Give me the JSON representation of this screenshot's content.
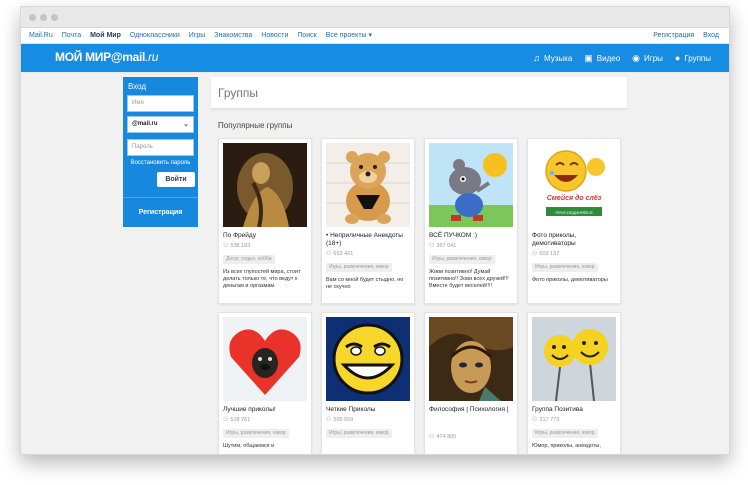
{
  "top_nav": {
    "left": [
      "Mail.Ru",
      "Почта",
      "Мой Мир",
      "Одноклассники",
      "Игры",
      "Знакомства",
      "Новости",
      "Поиск",
      "Все проекты ▾"
    ],
    "active": "Мой Мир",
    "right": [
      "Регистрация",
      "Вход"
    ]
  },
  "banner": {
    "logo_text": "МОЙ МИР@mail",
    "logo_suffix": ".ru",
    "nav": [
      {
        "icon": "music-icon",
        "label": "Музыка"
      },
      {
        "icon": "video-icon",
        "label": "Видео"
      },
      {
        "icon": "gamepad-icon",
        "label": "Игры"
      },
      {
        "icon": "groups-icon",
        "label": "Группы"
      }
    ]
  },
  "login": {
    "title": "Вход",
    "name_placeholder": "Имя",
    "domain_value": "@mail.ru",
    "password_placeholder": "Пароль",
    "restore_link": "Восстановить пароль",
    "submit_label": "Войти",
    "register_label": "Регистрация"
  },
  "page": {
    "title": "Группы",
    "subtitle": "Популярные группы"
  },
  "groups": [
    {
      "title": "По Фрейду",
      "members": "538 183",
      "tag": "Досуг, отдых, хобби",
      "desc": "Из всех глупостей мира, стоит делать только те, что ведут к деньгам и оргазмам."
    },
    {
      "title": "• Неприличные Анекдоты (18+)",
      "members": "653 421",
      "tag": "Игры, развлечения, юмор",
      "desc": "Вам со мной будет стыдно, но не скучно"
    },
    {
      "title": "ВСЁ ПУЧКОМ :)",
      "members": "367 041",
      "tag": "Игры, развлечения, юмор",
      "desc": "Живи позитивно! Думай позитивно!! Зови всех друзей!!! Вместе будет веселей!!!!"
    },
    {
      "title": "Фото приколы, демотиваторы",
      "members": "603 137",
      "tag": "Игры, развлечения, юмор",
      "desc": "Фото приколы, демотиваторы",
      "picture_text_1": "Смейся до слёз",
      "picture_text_2": "ПРИСОЕДИНЯЙСЯ"
    },
    {
      "title": "Лучшие приколы!",
      "members": "528 761",
      "tag": "Игры, развлечения, юмор",
      "desc": "Шутим, общаемся и"
    },
    {
      "title": "Четкие Приколы",
      "members": "505 659",
      "tag": "Игры, развлечения, юмор",
      "desc": ""
    },
    {
      "title": "Философия | Психология |",
      "members": "474 805",
      "tag": "",
      "desc": ""
    },
    {
      "title": "Группа Позитива",
      "members": "317 773",
      "tag": "Игры, развлечения, юмор",
      "desc": "Юмор, приколы, анекдоты,"
    }
  ]
}
